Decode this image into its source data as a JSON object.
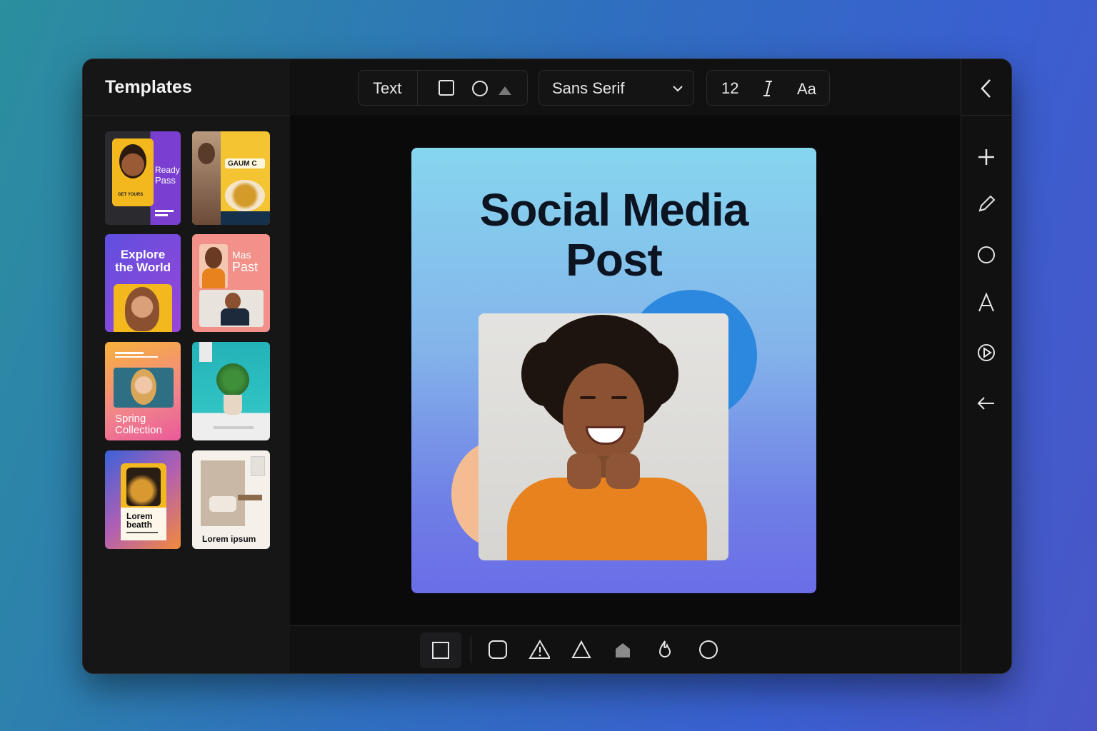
{
  "sidebar": {
    "title": "Templates",
    "templates": [
      {
        "name": "template-ready-pass",
        "lines": [
          "Ready",
          "Pass"
        ],
        "caption": "GET YOURS"
      },
      {
        "name": "template-gaum-c",
        "lines": [
          "GAUM C"
        ]
      },
      {
        "name": "template-explore-world",
        "lines": [
          "Explore",
          "the World"
        ]
      },
      {
        "name": "template-mas-past",
        "lines": [
          "Mas",
          "Past"
        ]
      },
      {
        "name": "template-spring-collection",
        "lines": [
          "Spring",
          "Collection"
        ]
      },
      {
        "name": "template-plant",
        "lines": []
      },
      {
        "name": "template-lorem-beatth",
        "lines": [
          "Lorem",
          "beatth"
        ]
      },
      {
        "name": "template-lorem-ipsum",
        "lines": [
          "Lorem ipsum"
        ]
      }
    ]
  },
  "toolbar": {
    "text_label": "Text",
    "font_family": "Sans Serif",
    "font_size": "12",
    "case_label": "Aa"
  },
  "canvas": {
    "post_title_line1": "Social Media",
    "post_title_line2": "Post"
  },
  "rail": {
    "icons": [
      "chevron-left-icon",
      "plus-icon",
      "pencil-icon",
      "circle-icon",
      "text-icon",
      "play-icon",
      "arrow-left-icon"
    ]
  },
  "bottombar": {
    "shapes": [
      "square-icon",
      "rounded-square-icon",
      "warning-triangle-icon",
      "triangle-icon",
      "home-shape-icon",
      "flame-icon",
      "circle-icon"
    ]
  },
  "colors": {
    "accent_blue": "#2b88de",
    "post_gradient_top": "#86d6ef",
    "post_gradient_bottom": "#6a6de7",
    "sweater_orange": "#e8821f"
  }
}
